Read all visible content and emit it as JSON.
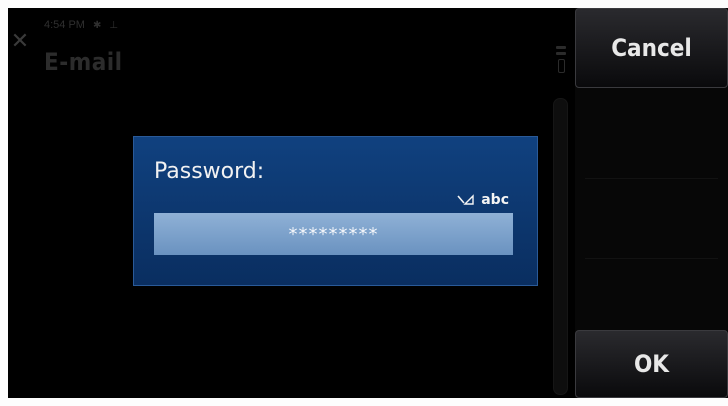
{
  "status_bar": {
    "time": "4:54 PM"
  },
  "app": {
    "title": "E-mail"
  },
  "dialog": {
    "title": "Password:",
    "input_mode": "abc",
    "password_masked": "*********"
  },
  "softkeys": {
    "cancel_label": "Cancel",
    "ok_label": "OK"
  },
  "icons": {
    "close": "close-icon",
    "bluetooth": "bluetooth-icon",
    "usb": "usb-icon",
    "menu": "menu-icon",
    "pen_input": "pen-input-icon"
  },
  "colors": {
    "dialog_bg": "#0d3a74",
    "field_bg": "#7fa2cb",
    "screen_bg": "#000000"
  }
}
